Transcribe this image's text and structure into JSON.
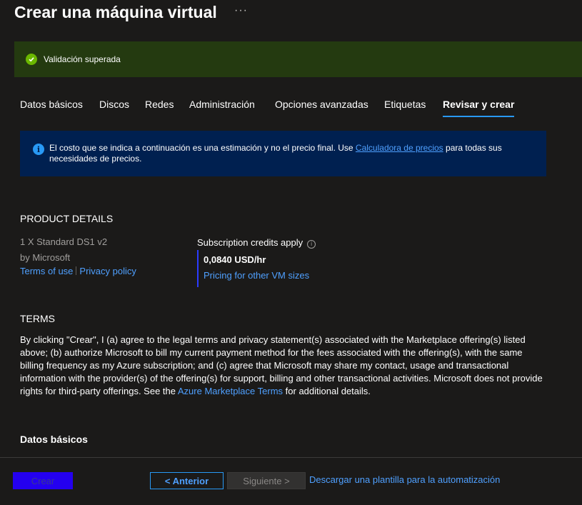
{
  "header": {
    "title": "Crear una máquina virtual",
    "more": "···"
  },
  "banner": {
    "text": "Validación superada",
    "icon": "checkmark-circle-icon",
    "color": "#6bb700"
  },
  "tabs": [
    {
      "label": "Datos básicos"
    },
    {
      "label": "Discos"
    },
    {
      "label": "Redes"
    },
    {
      "label": "Administración"
    },
    {
      "label": "Opciones avanzadas"
    },
    {
      "label": "Etiquetas"
    },
    {
      "label": "Revisar y crear",
      "active": true
    }
  ],
  "info_box": {
    "text_before": "El costo que se indica a continuación es una estimación y no el precio final. Use",
    "link": "Calculadora de precios",
    "text_after": "para todas sus necesidades de precios."
  },
  "product_details": {
    "heading": "PRODUCT DETAILS",
    "name": "1 X Standard DS1 v2",
    "publisher": "by Microsoft",
    "terms_link": "Terms of use",
    "privacy_link": "Privacy policy",
    "credits_label": "Subscription credits apply",
    "price": "0,0840 USD/hr",
    "pricing_link": "Pricing for other VM sizes"
  },
  "terms": {
    "heading": "TERMS",
    "text_before": "By clicking \"Crear\", I (a) agree to the legal terms and privacy statement(s) associated with the Marketplace offering(s) listed above; (b) authorize Microsoft to bill my current payment method for the fees associated with the offering(s), with the same billing frequency as my Azure subscription; and (c) agree that Microsoft may share my contact, usage and transactional information with the provider(s) of the offering(s) for support, billing and other transactional activities. Microsoft does not provide rights for third-party offerings. See the",
    "link": "Azure Marketplace Terms",
    "text_after": "for additional details."
  },
  "basics": {
    "heading": "Datos básicos"
  },
  "footer": {
    "create": "Crear",
    "previous": "< Anterior",
    "next": "Siguiente >",
    "download": "Descargar una plantilla para la automatización"
  },
  "colors": {
    "accent": "#2899f5",
    "link": "#4fa0ff",
    "banner_bg": "#243a10",
    "info_bg": "#002050",
    "create_button": "#2400f0"
  }
}
